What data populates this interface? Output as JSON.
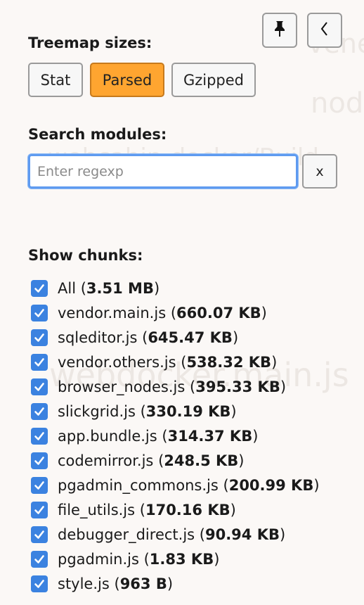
{
  "watermarks": [
    "vene",
    "nod",
    "webcabin-docker/Build",
    "webdocker.main.js"
  ],
  "controls": {
    "pin_icon": "pin-icon",
    "collapse_icon": "chevron-left-icon"
  },
  "treemap_sizes": {
    "title": "Treemap sizes:",
    "options": [
      "Stat",
      "Parsed",
      "Gzipped"
    ],
    "selected": "Parsed"
  },
  "search": {
    "title": "Search modules:",
    "placeholder": "Enter regexp",
    "value": "",
    "clear_label": "x"
  },
  "chunks": {
    "title": "Show chunks:",
    "items": [
      {
        "name": "All",
        "size": "3.51 MB",
        "checked": true
      },
      {
        "name": "vendor.main.js",
        "size": "660.07 KB",
        "checked": true
      },
      {
        "name": "sqleditor.js",
        "size": "645.47 KB",
        "checked": true
      },
      {
        "name": "vendor.others.js",
        "size": "538.32 KB",
        "checked": true
      },
      {
        "name": "browser_nodes.js",
        "size": "395.33 KB",
        "checked": true
      },
      {
        "name": "slickgrid.js",
        "size": "330.19 KB",
        "checked": true
      },
      {
        "name": "app.bundle.js",
        "size": "314.37 KB",
        "checked": true
      },
      {
        "name": "codemirror.js",
        "size": "248.5 KB",
        "checked": true
      },
      {
        "name": "pgadmin_commons.js",
        "size": "200.99 KB",
        "checked": true
      },
      {
        "name": "file_utils.js",
        "size": "170.16 KB",
        "checked": true
      },
      {
        "name": "debugger_direct.js",
        "size": "90.94 KB",
        "checked": true
      },
      {
        "name": "pgadmin.js",
        "size": "1.83 KB",
        "checked": true
      },
      {
        "name": "style.js",
        "size": "963 B",
        "checked": true
      }
    ]
  },
  "colors": {
    "accent_selected": "#ffa530",
    "checkbox": "#3b82e0",
    "focus_border": "#5f9bf0",
    "panel_bg": "#fbf8f6"
  }
}
